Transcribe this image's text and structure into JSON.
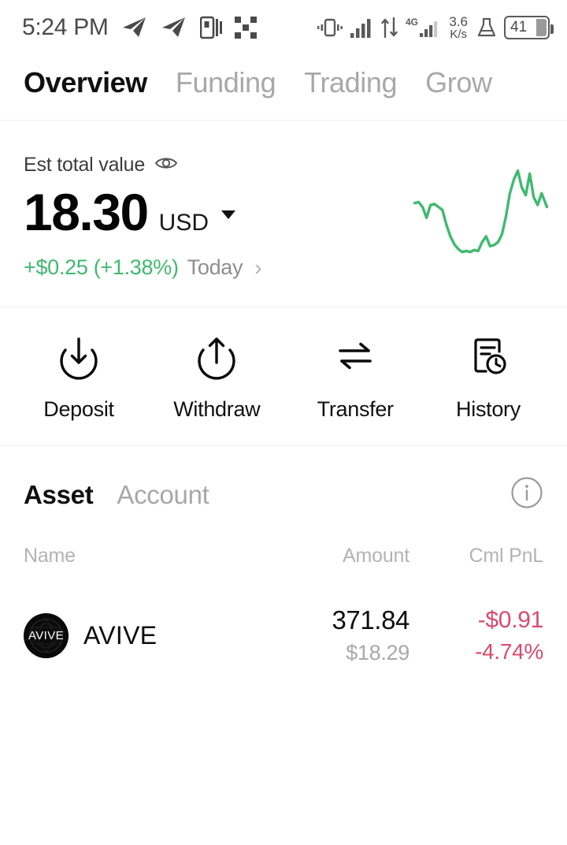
{
  "status_bar": {
    "time": "5:24 PM",
    "left_icons": [
      "telegram-icon",
      "telegram-icon",
      "parallel-space-icon",
      "qr-dots-icon"
    ],
    "right_icons": [
      "vibrate-icon",
      "signal-bars-icon",
      "data-transfer-icon",
      "signal-4g-icon",
      "lab-flask-icon"
    ],
    "network_type": "4G",
    "data_rate_value": "3.6",
    "data_rate_unit": "K/s",
    "battery_level": "41"
  },
  "top_tabs": [
    {
      "label": "Overview",
      "active": true
    },
    {
      "label": "Funding",
      "active": false
    },
    {
      "label": "Trading",
      "active": false
    },
    {
      "label": "Grow",
      "active": false
    }
  ],
  "balance": {
    "label": "Est total value",
    "visibility_icon": "eye-icon",
    "amount": "18.30",
    "currency": "USD",
    "currency_caret": "chevron-down-icon",
    "change": "+$0.25 (+1.38%)",
    "period": "Today",
    "detail_chevron": "chevron-right-icon",
    "change_color": "#3FBA6E"
  },
  "chart_data": {
    "type": "line",
    "title": "",
    "xlabel": "",
    "ylabel": "",
    "grid": false,
    "legend": false,
    "series": [
      {
        "name": "Est total value",
        "color": "#3FBA6E",
        "x": [
          0,
          3,
          6,
          9,
          12,
          15,
          18,
          21,
          24,
          27,
          30,
          33,
          36,
          39,
          42,
          45,
          48,
          51,
          54,
          57,
          60,
          63,
          66,
          69,
          72,
          75,
          78,
          81,
          84,
          87,
          90,
          93,
          96,
          100
        ],
        "values": [
          62,
          63,
          58,
          47,
          60,
          61,
          58,
          55,
          40,
          28,
          20,
          15,
          12,
          13,
          12,
          14,
          13,
          22,
          28,
          18,
          19,
          22,
          30,
          48,
          72,
          86,
          95,
          78,
          70,
          92,
          68,
          60,
          72,
          58
        ]
      }
    ],
    "ylim": [
      0,
      100
    ],
    "xlim": [
      0,
      100
    ]
  },
  "actions": [
    {
      "label": "Deposit",
      "icon": "download-circle-icon"
    },
    {
      "label": "Withdraw",
      "icon": "upload-circle-icon"
    },
    {
      "label": "Transfer",
      "icon": "transfer-arrows-icon"
    },
    {
      "label": "History",
      "icon": "document-clock-icon"
    }
  ],
  "asset_tabs": [
    {
      "label": "Asset",
      "active": true
    },
    {
      "label": "Account",
      "active": false
    }
  ],
  "asset_info_icon": "info-circle-icon",
  "table": {
    "headers": {
      "name": "Name",
      "amount": "Amount",
      "pnl": "Cml PnL"
    },
    "rows": [
      {
        "logo_text": "AVIVE",
        "symbol": "AVIVE",
        "amount": "371.84",
        "amount_usd": "$18.29",
        "pnl_value": "-$0.91",
        "pnl_percent": "-4.74%",
        "pnl_color": "#D94A6E"
      }
    ]
  }
}
